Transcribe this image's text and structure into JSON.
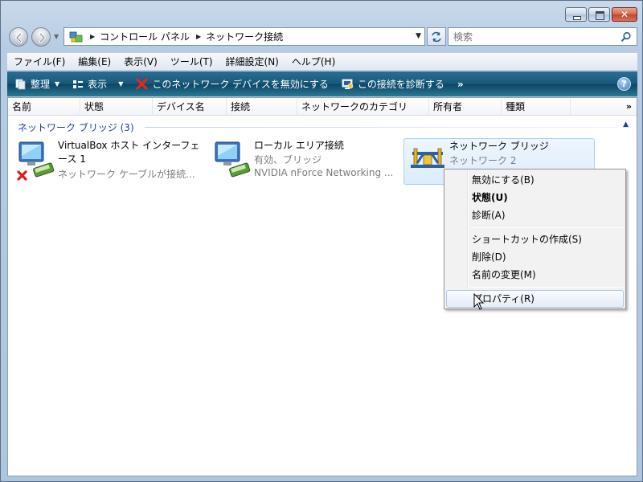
{
  "address": {
    "crumbs": [
      "コントロール パネル",
      "ネットワーク接続"
    ]
  },
  "search": {
    "placeholder": "検索"
  },
  "menu": [
    "ファイル(F)",
    "編集(E)",
    "表示(V)",
    "ツール(T)",
    "詳細設定(N)",
    "ヘルプ(H)"
  ],
  "toolbar": {
    "organize": "整理",
    "view": "表示",
    "disable": "このネットワーク デバイスを無効にする",
    "diagnose": "この接続を診断する",
    "more": "»",
    "help": "?"
  },
  "columns": [
    "名前",
    "状態",
    "デバイス名",
    "接続",
    "ネットワークのカテゴリ",
    "所有者",
    "種類"
  ],
  "columns_more": "»",
  "group": {
    "title": "ネットワーク ブリッジ (3)"
  },
  "items": [
    {
      "name": "VirtualBox ホスト インターフェース 1",
      "status": "ネットワーク ケーブルが接続...",
      "disconnected": true
    },
    {
      "name": "ローカル エリア接続",
      "status": "有効、ブリッジ",
      "device": "NVIDIA nForce Networking ..."
    },
    {
      "name": "ネットワーク ブリッジ",
      "status": "ネットワーク 2"
    }
  ],
  "context_menu": {
    "disable": "無効にする(B)",
    "status": "状態(U)",
    "diagnose": "診断(A)",
    "shortcut": "ショートカットの作成(S)",
    "delete": "削除(D)",
    "rename": "名前の変更(M)",
    "properties": "プロパティ(R)"
  },
  "colors": {
    "toolbar": "#185878",
    "group_title": "#1e3ea6",
    "selection": "#dcecfb"
  }
}
